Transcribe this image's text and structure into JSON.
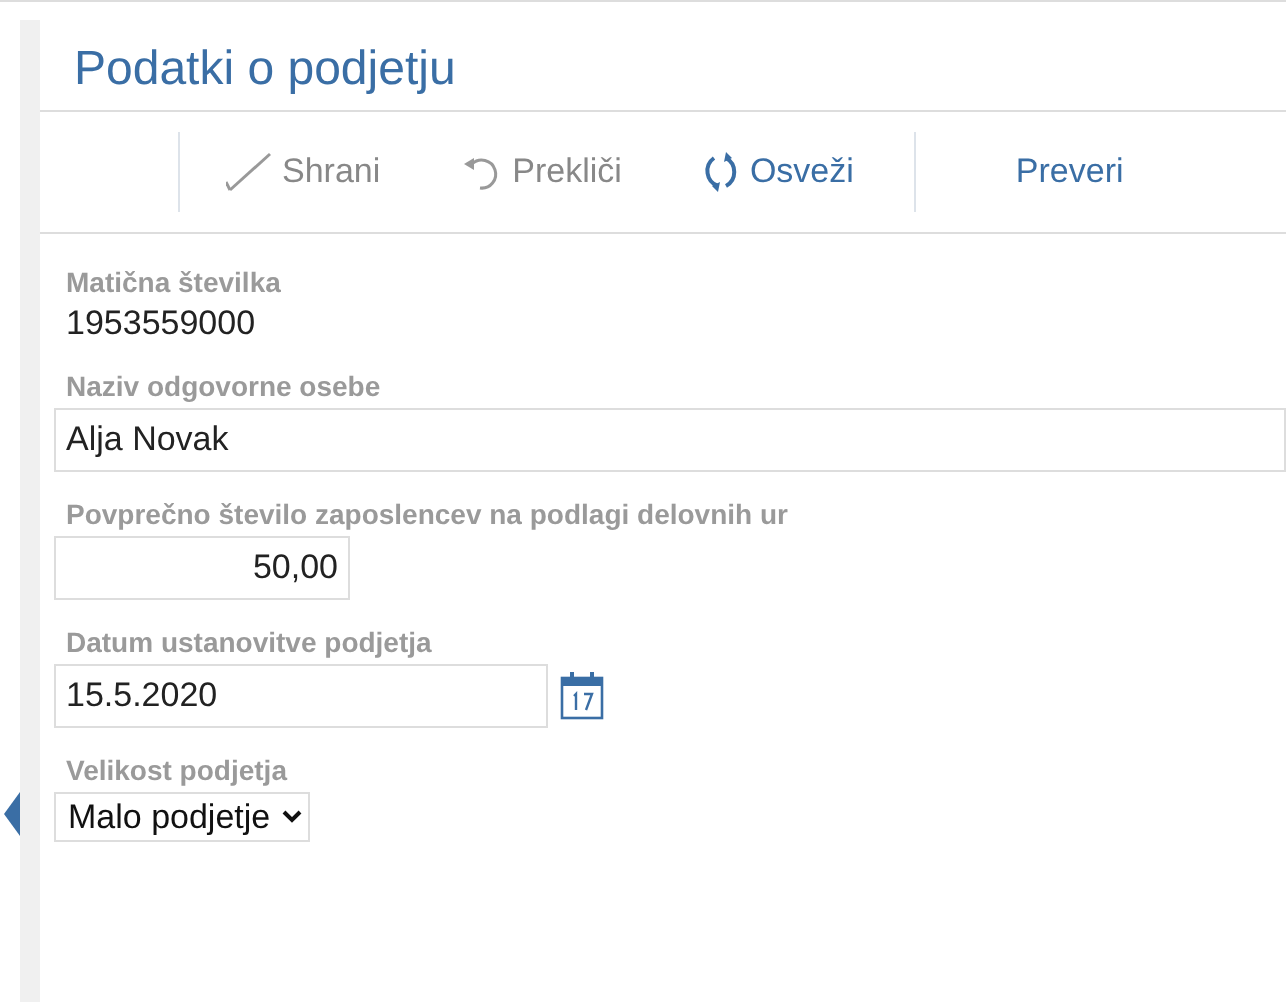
{
  "title": "Podatki o podjetju",
  "toolbar": [
    {
      "kind": "check",
      "label": "Shrani",
      "disabled": true
    },
    {
      "kind": "undo",
      "label": "Prekliči",
      "disabled": true
    },
    {
      "kind": "refresh",
      "label": "Osveži",
      "disabled": false
    },
    {
      "kind": "plain",
      "label": "Preveri",
      "disabled": false
    }
  ],
  "fields": [
    {
      "kind": "static",
      "label": "Matična številka",
      "value": "1953559000"
    },
    {
      "kind": "text",
      "label": "Naziv odgovorne osebe",
      "value": "Alja Novak"
    },
    {
      "kind": "number",
      "label": "Povprečno število zaposlencev na podlagi delovnih ur",
      "value": "50,00"
    },
    {
      "kind": "date",
      "label": "Datum ustanovitve podjetja",
      "value": "15.5.2020"
    },
    {
      "kind": "select",
      "label": "Velikost podjetja",
      "value": "Malo podjetje"
    }
  ]
}
